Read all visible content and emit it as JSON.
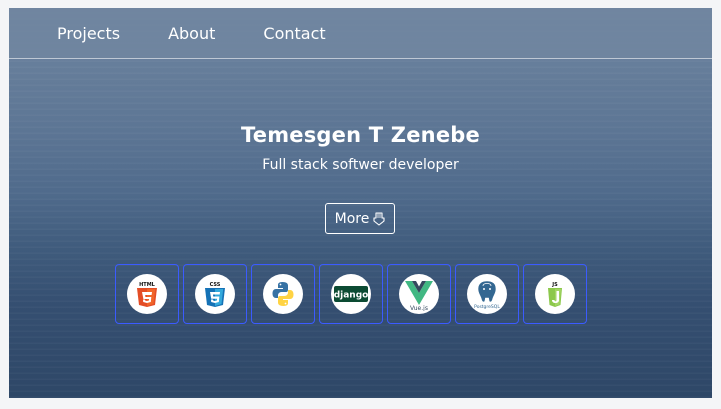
{
  "nav": {
    "items": [
      "Projects",
      "About",
      "Contact"
    ]
  },
  "hero": {
    "name": "Temesgen T Zenebe",
    "subtitle": "Full stack softwer developer",
    "more_label": "More"
  },
  "skills": [
    {
      "name": "HTML5",
      "icon": "html5-icon"
    },
    {
      "name": "CSS3",
      "icon": "css3-icon"
    },
    {
      "name": "Python",
      "icon": "python-icon"
    },
    {
      "name": "django",
      "icon": "django-icon"
    },
    {
      "name": "Vue.js",
      "icon": "vue-icon"
    },
    {
      "name": "PostgreSQL",
      "icon": "postgresql-icon"
    },
    {
      "name": "JS",
      "icon": "javascript-icon"
    }
  ],
  "colors": {
    "skill_border": "#3b5bff",
    "header_bg": "#7085a0",
    "text": "#ffffff"
  }
}
